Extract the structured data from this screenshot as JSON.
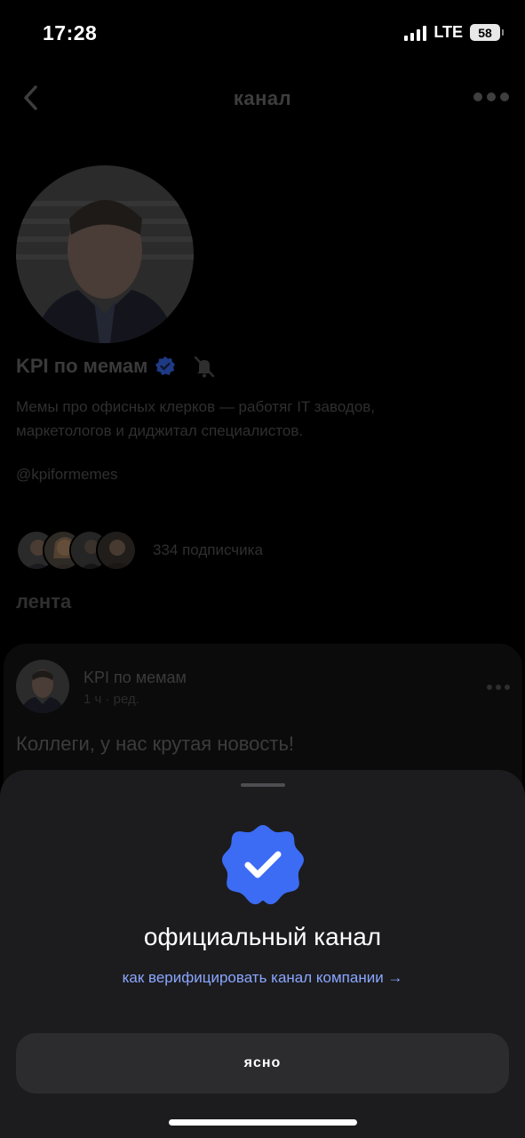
{
  "status_bar": {
    "time": "17:28",
    "network": "LTE",
    "battery": "58"
  },
  "nav": {
    "title": "канал"
  },
  "channel": {
    "name": "KPI по мемам",
    "description_line1": "Мемы про офисных клерков — работяг IT заводов,",
    "description_line2": "маркетологов и диджитал специалистов.",
    "handle": "@kpiformemes",
    "subscribers": "334 подписчика"
  },
  "feed": {
    "title": "лента",
    "post": {
      "author": "KPI по мемам",
      "meta": "1 ч · ред.",
      "text": "Коллеги, у нас крутая новость!"
    }
  },
  "sheet": {
    "title": "официальный канал",
    "link": "как верифицировать канал компании →",
    "button": "ясно"
  },
  "colors": {
    "accent": "#3c6cf4",
    "link": "#8aa6ff",
    "sheet_bg": "#1c1c1e"
  }
}
